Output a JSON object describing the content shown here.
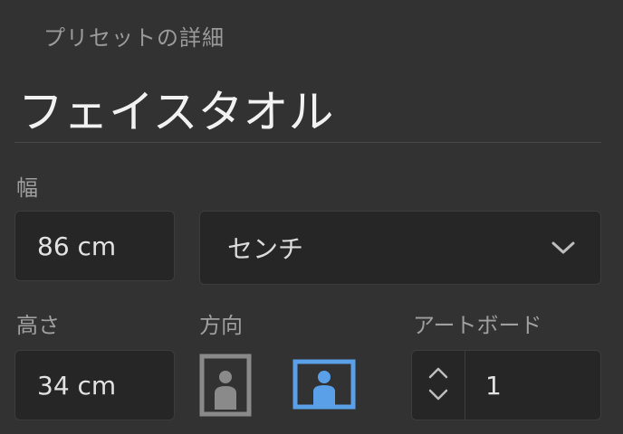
{
  "panel": {
    "section_label": "プリセットの詳細",
    "preset_name": "フェイスタオル"
  },
  "width": {
    "label": "幅",
    "value": "86 cm",
    "unit": "センチ"
  },
  "height": {
    "label": "高さ",
    "value": "34 cm"
  },
  "orientation": {
    "label": "方向",
    "options": [
      "portrait",
      "landscape"
    ],
    "selected": "landscape",
    "accent_color": "#5aa0e8",
    "inactive_color": "#8a8a8a"
  },
  "artboards": {
    "label": "アートボード",
    "value": "1"
  },
  "icons": {
    "unit_dropdown": "chevron-down-icon",
    "increment": "chevron-up-icon",
    "decrement": "chevron-down-icon",
    "portrait": "portrait-orientation-icon",
    "landscape": "landscape-orientation-icon"
  }
}
